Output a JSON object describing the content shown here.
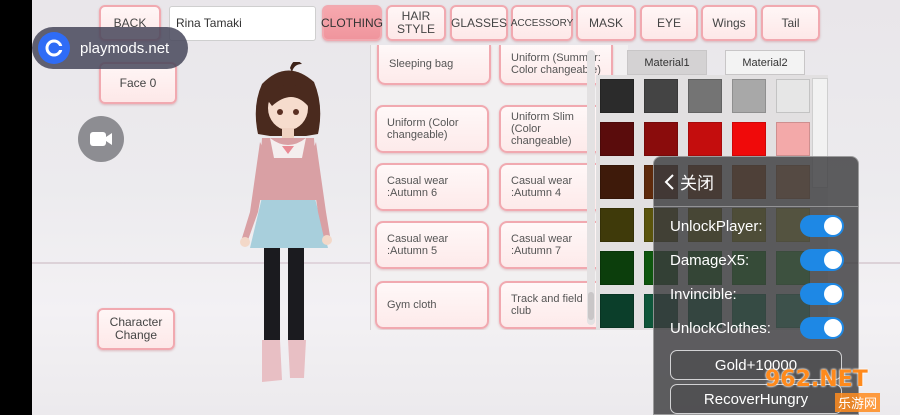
{
  "top_bar": {
    "back_label": "BACK",
    "name_value": "Rina Tamaki",
    "tabs": [
      {
        "label": "CLOTHING",
        "active": true
      },
      {
        "label": "HAIR\nSTYLE",
        "active": false
      },
      {
        "label": "GLASSES",
        "active": false
      },
      {
        "label": "ACCESSORY",
        "active": false
      },
      {
        "label": "MASK",
        "active": false
      },
      {
        "label": "EYE",
        "active": false
      },
      {
        "label": "Wings",
        "active": false
      },
      {
        "label": "Tail",
        "active": false
      }
    ]
  },
  "badge": {
    "text": "playmods.net",
    "icon": "playmods-logo-icon"
  },
  "left": {
    "face_label": "Face 0",
    "character_change_label": "Character\nChange",
    "camera_icon": "video-camera-icon"
  },
  "clothing_list": [
    {
      "label": "Sleeping bag"
    },
    {
      "label": "Uniform (Summer: Color changeable)"
    },
    {
      "label": "Uniform (Color changeable)"
    },
    {
      "label": "Uniform Slim (Color changeable)"
    },
    {
      "label": "Casual wear :Autumn 6"
    },
    {
      "label": "Casual wear :Autumn 4"
    },
    {
      "label": "Casual wear :Autumn 5"
    },
    {
      "label": "Casual wear :Autumn 7"
    },
    {
      "label": "Gym cloth"
    },
    {
      "label": "Track and field club"
    }
  ],
  "material": {
    "tabs": [
      {
        "label": "Material1",
        "active": false
      },
      {
        "label": "Material2",
        "active": true
      }
    ],
    "swatches": [
      [
        "#2b2b2b",
        "#444444",
        "#747474",
        "#a8a8a8",
        "#e6e6e6"
      ],
      [
        "#5a0c0c",
        "#8a0c0c",
        "#c40d0d",
        "#f00a0a",
        "#f3a9a9"
      ],
      [
        "#3e1a0a",
        "#5e2a0c",
        "#7b3a10",
        "#a2561e",
        "#c98a5a"
      ],
      [
        "#3f3a0a",
        "#5a540c",
        "#7b7410",
        "#a39a1e",
        "#c4bc48"
      ],
      [
        "#0c3e0c",
        "#0e560e",
        "#127012",
        "#1f8f1f",
        "#46b046"
      ],
      [
        "#0b3e2a",
        "#0e563a",
        "#12704c",
        "#1f8f62",
        "#45b083"
      ]
    ]
  },
  "cheat_menu": {
    "close_label": "关闭",
    "toggles": [
      {
        "label": "UnlockPlayer:",
        "on": true
      },
      {
        "label": "DamageX5:",
        "on": true
      },
      {
        "label": "Invincible:",
        "on": true
      },
      {
        "label": "UnlockClothes:",
        "on": true
      }
    ],
    "buttons": [
      {
        "label": "Gold+10000"
      },
      {
        "label": "RecoverHungry"
      }
    ]
  },
  "watermark": {
    "text": "962.NET",
    "sub": "乐游网"
  }
}
